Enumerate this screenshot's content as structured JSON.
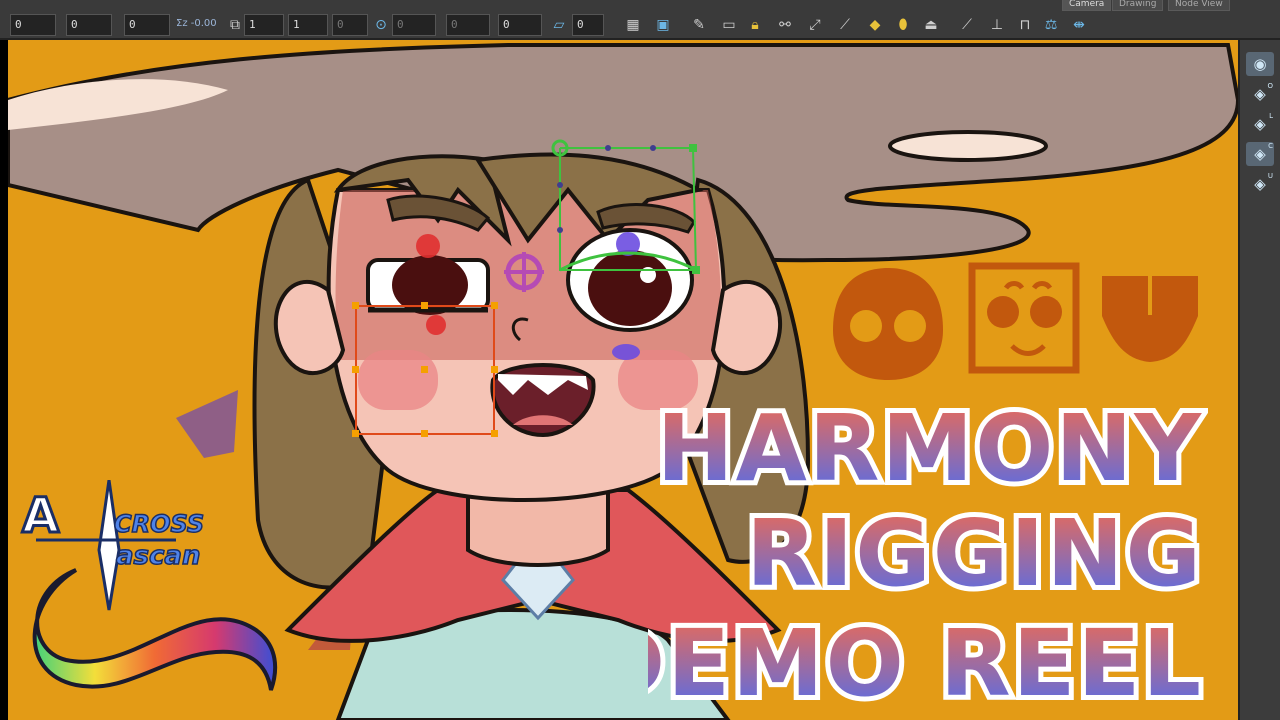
{
  "toolbar": {
    "fields": [
      "0",
      "0",
      "0",
      "1",
      "1",
      "0",
      "0"
    ],
    "dim_fields": [
      "0",
      "0",
      "0"
    ],
    "scale_label": "-0.00",
    "view_tabs": [
      "Camera",
      "Drawing",
      "Node View"
    ]
  },
  "icons": [
    "grid-icon",
    "tool-icon",
    "pencil-icon",
    "lock-icon",
    "padlock-icon",
    "link-icon",
    "transform-icon",
    "camera-icon",
    "eraser-icon",
    "bell-icon",
    "paint-bucket-icon",
    "tilt-icon",
    "balance-icon",
    "scale-icon"
  ],
  "rail": [
    {
      "name": "eye-view-button",
      "glyph": "◉",
      "sup": ""
    },
    {
      "name": "layer-o-button",
      "glyph": "◈",
      "sup": "O"
    },
    {
      "name": "layer-l-button",
      "glyph": "◈",
      "sup": "L"
    },
    {
      "name": "layer-c-button",
      "glyph": "◈",
      "sup": "C"
    },
    {
      "name": "layer-u-button",
      "glyph": "◈",
      "sup": "U"
    }
  ],
  "title": {
    "line1": "HARMONY",
    "line2": "RIGGING",
    "line3": "DEMO REEL",
    "gradient_top": "#f26a4f",
    "gradient_bottom": "#4d6df0"
  },
  "logo": {
    "text_top": "CROSS",
    "text_bottom": "ascan",
    "initial": "A"
  },
  "colors": {
    "background": "#e39b16",
    "hat": "#a78f87",
    "skin": "#f5c4b6",
    "hair": "#8b7148",
    "cape": "#e0575a",
    "shirt": "#b8e0d8"
  }
}
